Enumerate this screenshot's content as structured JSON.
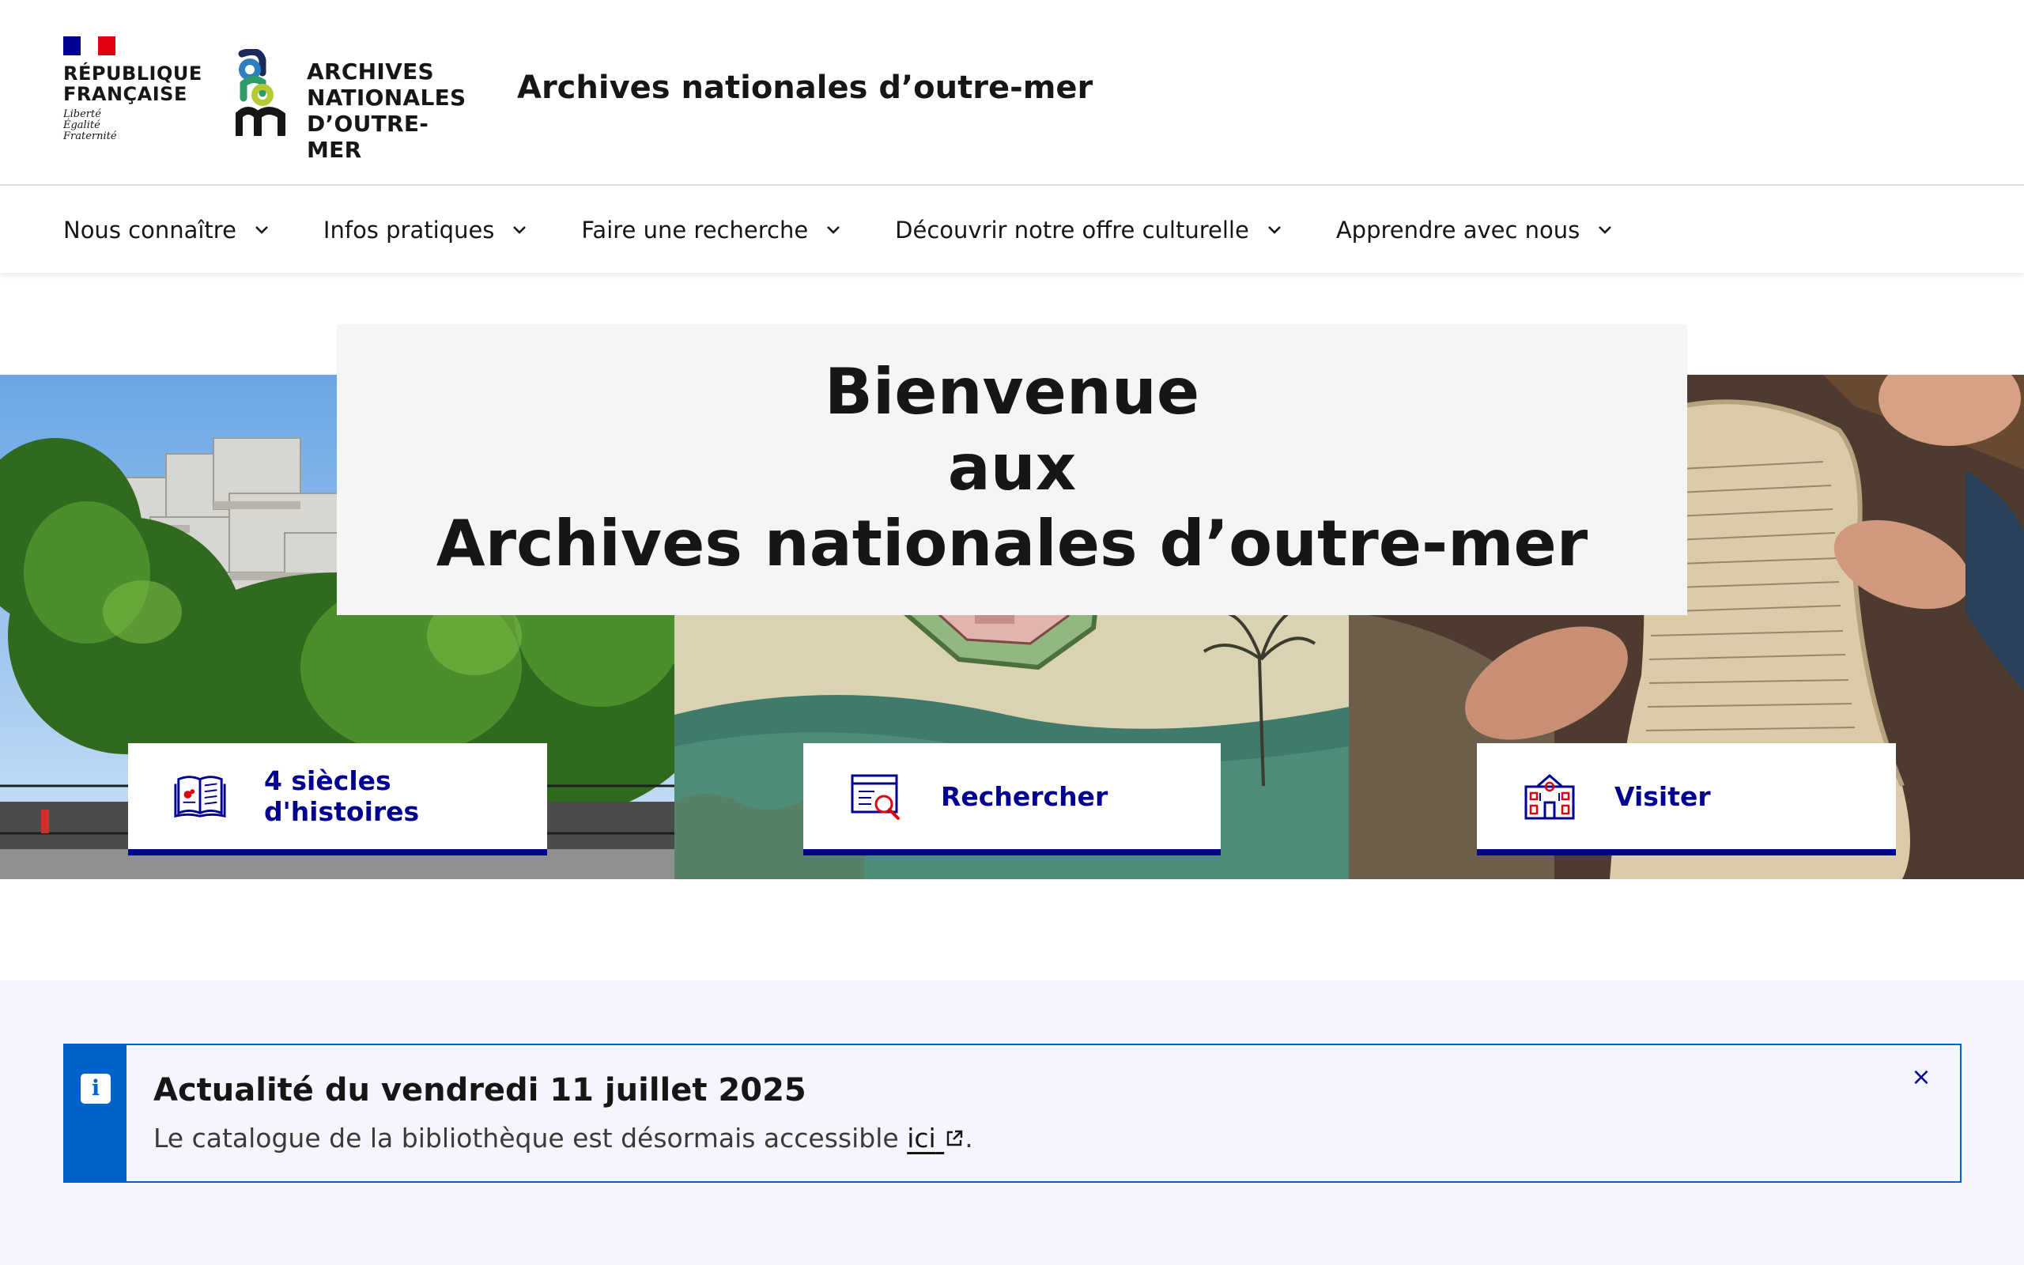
{
  "header": {
    "rf": {
      "line1": "RÉPUBLIQUE",
      "line2": "FRANÇAISE",
      "motto1": "Liberté",
      "motto2": "Égalité",
      "motto3": "Fraternité"
    },
    "anom": {
      "line1": "ARCHIVES",
      "line2": "NATIONALES",
      "line3": "D’OUTRE-MER"
    },
    "site_title": "Archives nationales d’outre-mer"
  },
  "nav": {
    "items": [
      {
        "label": "Nous connaître"
      },
      {
        "label": "Infos pratiques"
      },
      {
        "label": "Faire une recherche"
      },
      {
        "label": "Découvrir notre offre culturelle"
      },
      {
        "label": "Apprendre avec nous"
      }
    ]
  },
  "hero": {
    "welcome_line1": "Bienvenue",
    "welcome_line2": "aux",
    "welcome_line3": "Archives nationales d’outre-mer",
    "tiles": [
      {
        "label": "4 siècles d'histoires",
        "icon": "open-book-icon"
      },
      {
        "label": "Rechercher",
        "icon": "search-document-icon"
      },
      {
        "label": "Visiter",
        "icon": "building-icon"
      }
    ]
  },
  "notice": {
    "title": "Actualité du vendredi 11 juillet 2025",
    "text_before": "Le catalogue de la bibliothèque est désormais accessible ",
    "link_label": "ici",
    "text_after": ".",
    "close_label": "×"
  },
  "colors": {
    "brand_blue": "#000091",
    "info_blue": "#0063cb",
    "marianne_red": "#e1000f",
    "hero_box_bg": "#f5f5f5",
    "notice_bg": "#f4f5fd"
  }
}
